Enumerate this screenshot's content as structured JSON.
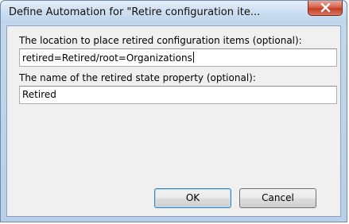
{
  "dialog": {
    "title": "Define Automation for \"Retire configuration ite...",
    "location_label": "The location to place retired configuration items (optional):",
    "location_value": "retired=Retired/root=Organizations",
    "state_label": "The name of the retired state property (optional):",
    "state_value": "Retired",
    "ok_label": "OK",
    "cancel_label": "Cancel"
  },
  "icons": {
    "close": "close-icon"
  },
  "colors": {
    "close_button": "#c13d24",
    "title_bar": "#cddff1",
    "client_background": "#f0f0f0"
  }
}
